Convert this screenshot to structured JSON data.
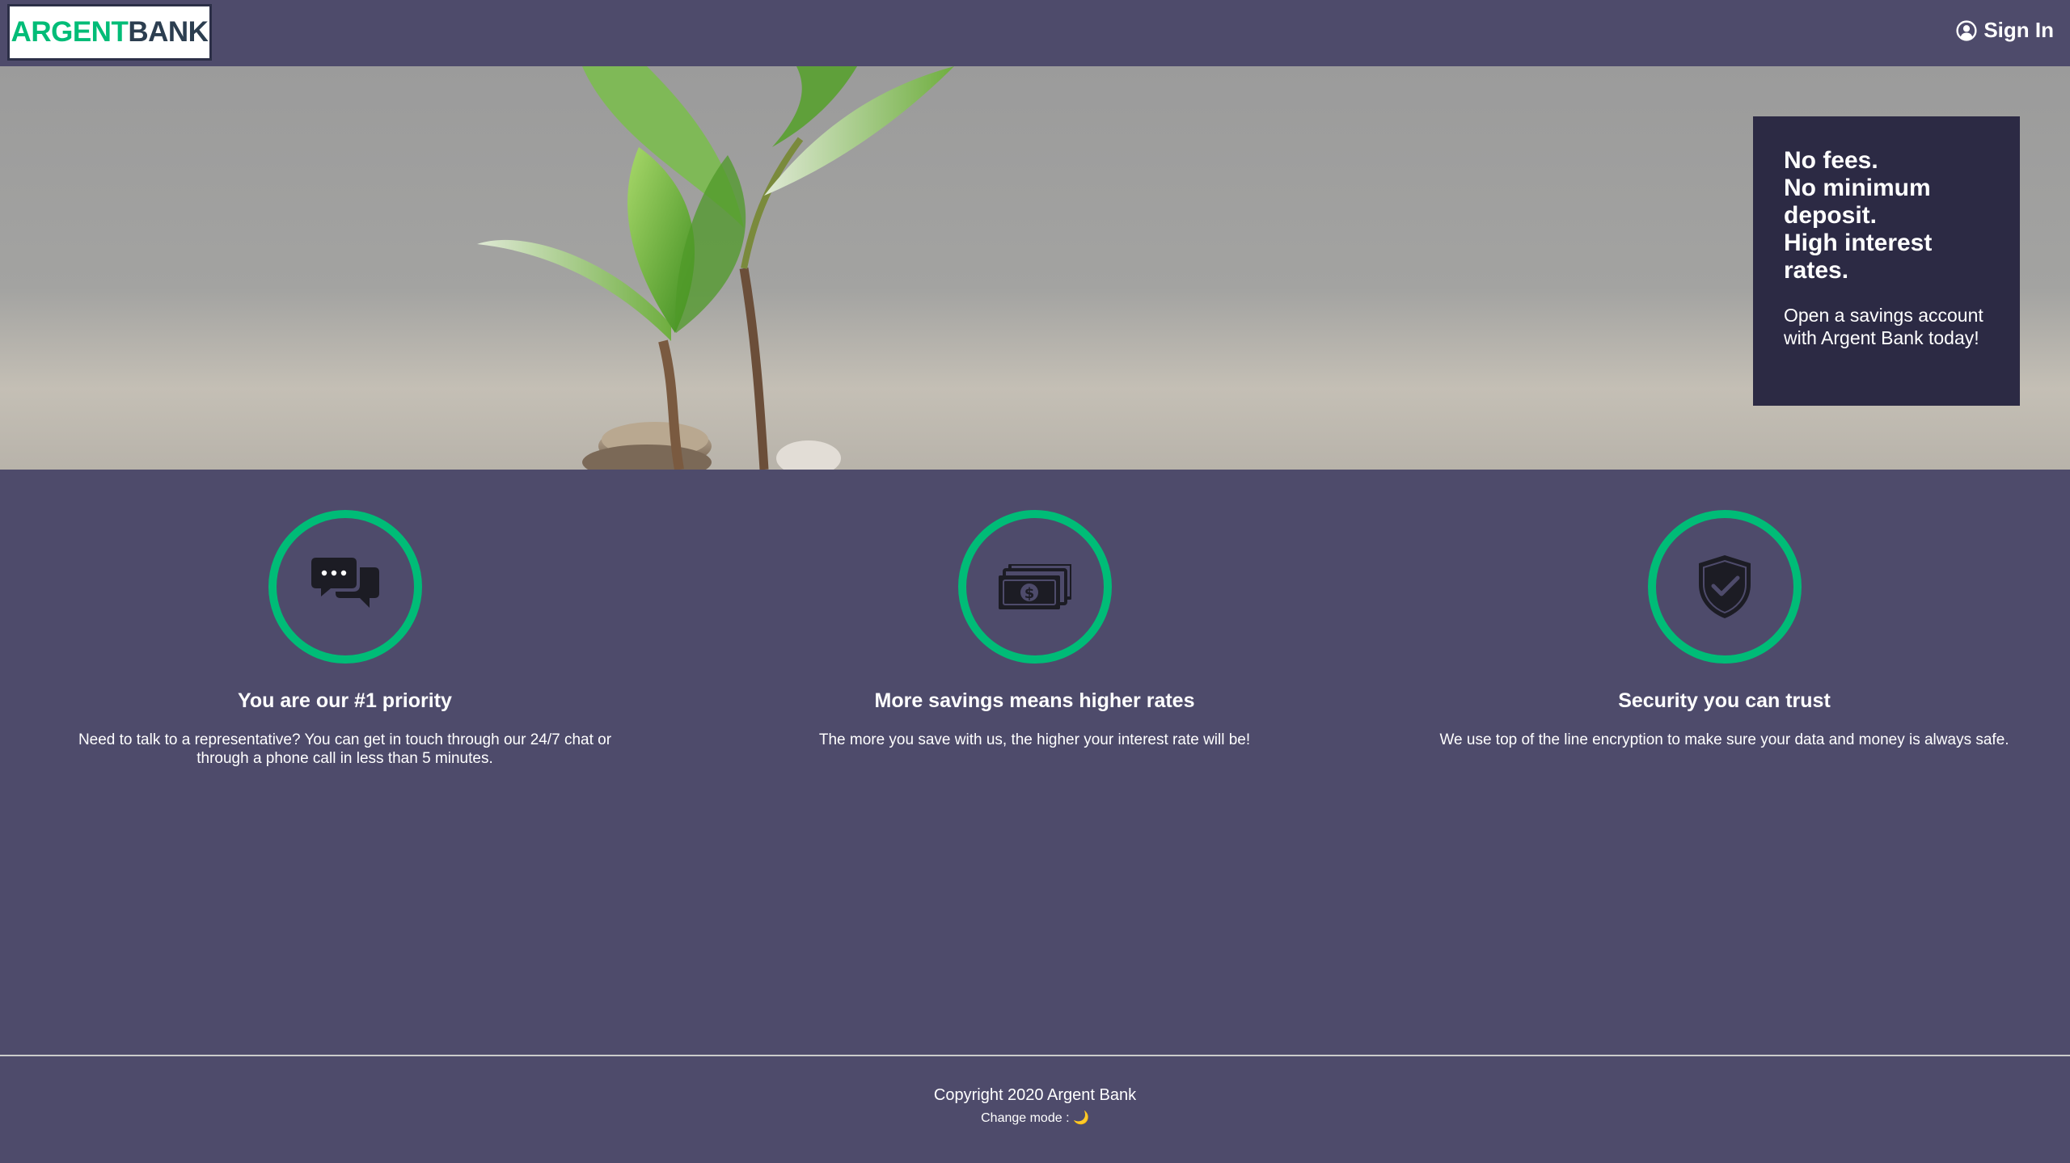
{
  "header": {
    "logo_part1": "ARGENT",
    "logo_part2": "BANK",
    "signin_label": "Sign In",
    "signin_icon": "user-circle-icon"
  },
  "hero": {
    "subtitles": [
      "No fees.",
      "No minimum deposit.",
      "High interest rates."
    ],
    "text": "Open a savings account with Argent Bank today!"
  },
  "features": [
    {
      "icon": "chat-icon",
      "title": "You are our #1 priority",
      "text": "Need to talk to a representative? You can get in touch through our 24/7 chat or through a phone call in less than 5 minutes."
    },
    {
      "icon": "money-icon",
      "title": "More savings means higher rates",
      "text": "The more you save with us, the higher your interest rate will be!"
    },
    {
      "icon": "security-shield-icon",
      "title": "Security you can trust",
      "text": "We use top of the line encryption to make sure your data and money is always safe."
    }
  ],
  "footer": {
    "copyright": "Copyright 2020 Argent Bank",
    "change_mode_label": "Change mode :",
    "change_mode_icon": "🌙"
  },
  "colors": {
    "background": "#4e4b6b",
    "accent": "#00bc77",
    "promo_bg": "#2c2a44"
  }
}
